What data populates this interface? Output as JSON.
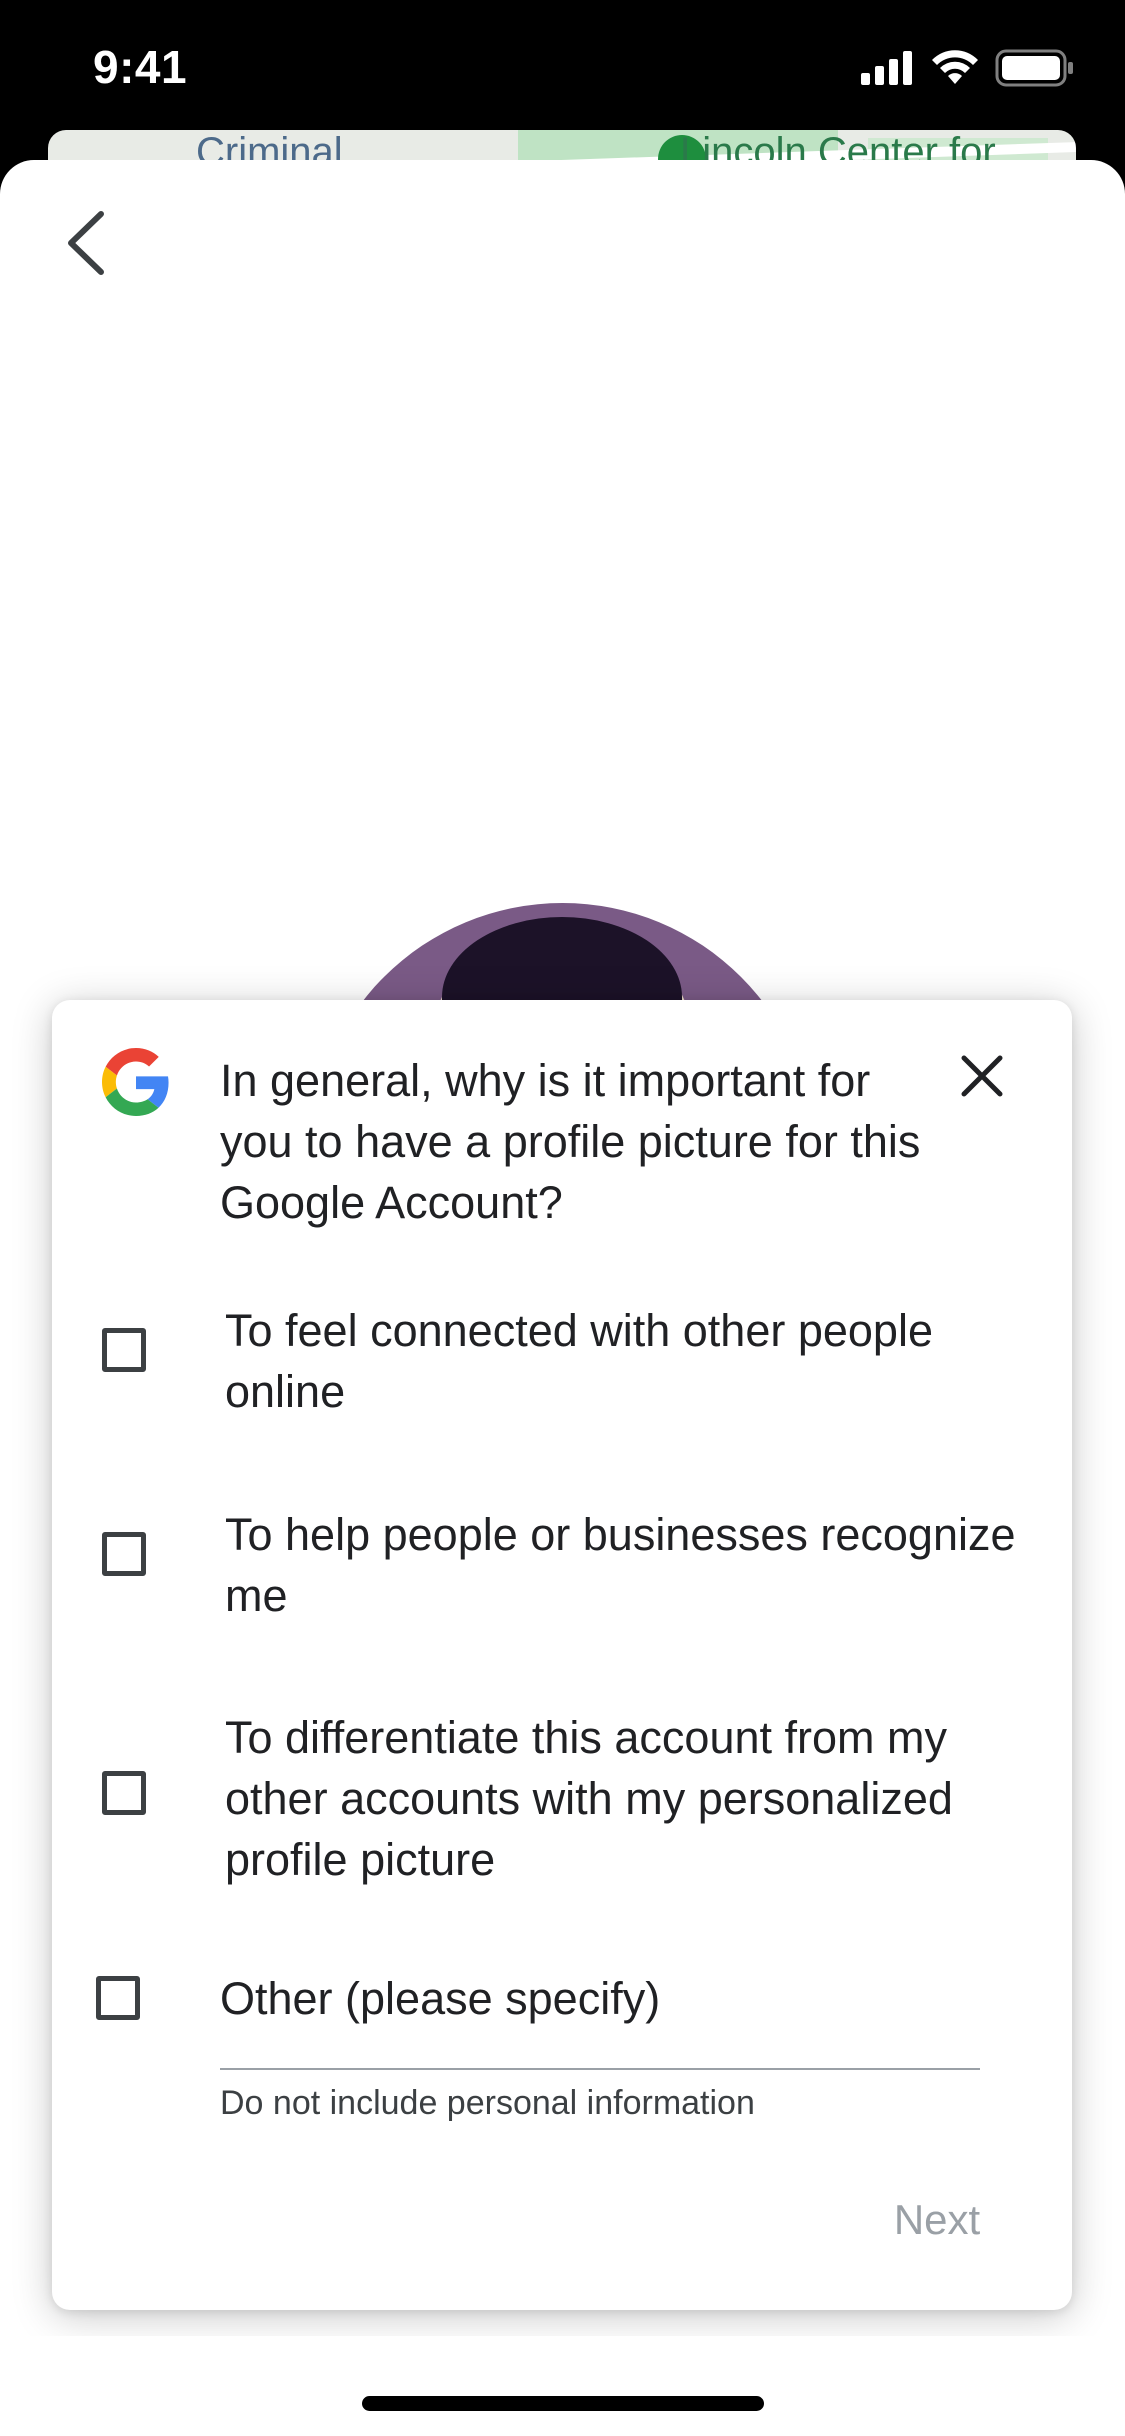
{
  "status_bar": {
    "time": "9:41",
    "icons": [
      "cellular-signal-icon",
      "wifi-icon",
      "battery-icon"
    ]
  },
  "map_background": {
    "labels": [
      "Criminal",
      "Lincoln Center for"
    ]
  },
  "header": {
    "back_icon": "chevron-left-icon"
  },
  "survey": {
    "logo": "google-g-logo",
    "question": "In general, why is it important for you to have a profile picture for this Google Account?",
    "close_icon": "close-icon",
    "options": [
      {
        "label": "To feel connected with other people online",
        "checked": false
      },
      {
        "label": "To help people or businesses recognize me",
        "checked": false
      },
      {
        "label": "To differentiate this account from my other accounts with my personalized profile picture",
        "checked": false
      },
      {
        "label": "Other (please specify)",
        "checked": false
      }
    ],
    "other_input_value": "",
    "hint": "Do not include personal information",
    "next_label": "Next"
  },
  "colors": {
    "text": "#202124",
    "disabled": "#9aa0a6",
    "google_blue": "#4285F4",
    "google_red": "#EA4335",
    "google_yellow": "#FBBC05",
    "google_green": "#34A853"
  }
}
